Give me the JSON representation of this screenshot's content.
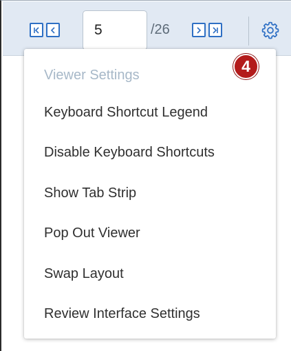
{
  "toolbar": {
    "page_value": "5",
    "page_total": "/26",
    "icons": {
      "first": "first-page-icon",
      "prev": "previous-page-icon",
      "next": "next-page-icon",
      "last": "last-page-icon",
      "settings": "gear-icon"
    }
  },
  "menu": {
    "header": "Viewer Settings",
    "items": [
      {
        "label": "Keyboard Shortcut Legend"
      },
      {
        "label": "Disable Keyboard Shortcuts"
      },
      {
        "label": "Show Tab Strip"
      },
      {
        "label": "Pop Out Viewer"
      },
      {
        "label": "Swap Layout"
      },
      {
        "label": "Review Interface Settings"
      }
    ]
  },
  "callout": {
    "number": "4"
  },
  "colors": {
    "accent": "#2e6fc4",
    "toolbar_bg": "#e1e9f3",
    "header_text": "#a7b8c8",
    "callout_red": "#b31b1b"
  }
}
